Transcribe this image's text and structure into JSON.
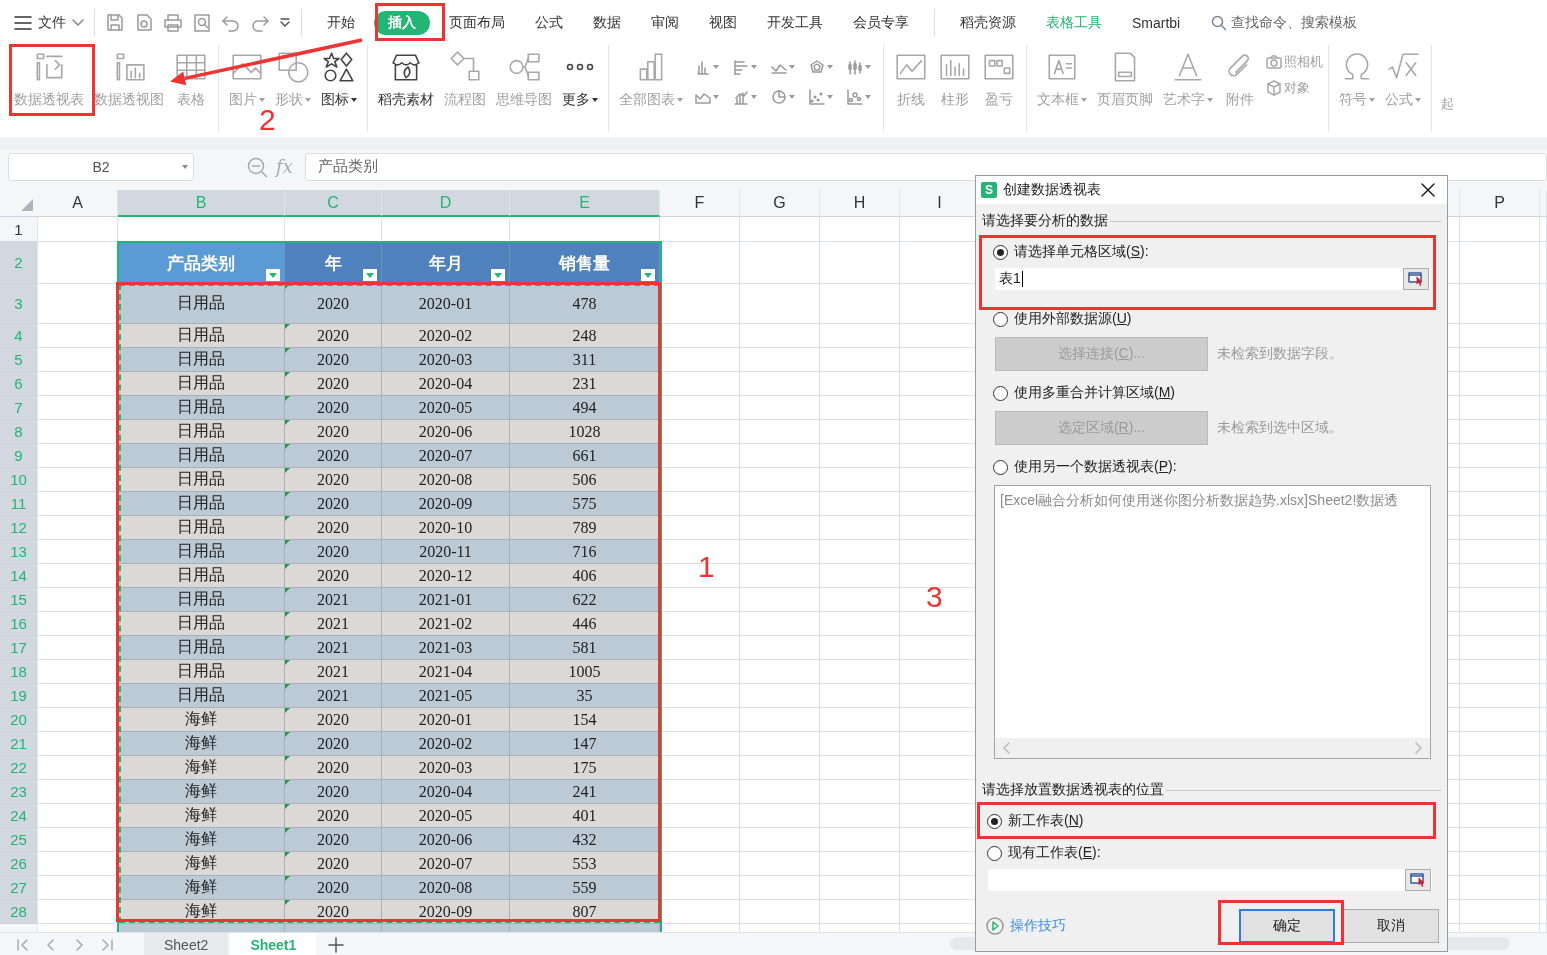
{
  "top_bar": {
    "menu_label": "文件",
    "tabs": [
      {
        "label": "开始",
        "selected": false,
        "kind": "tab"
      },
      {
        "label": "插入",
        "selected": true,
        "kind": "tab"
      },
      {
        "label": "页面布局",
        "selected": false,
        "kind": "tab"
      },
      {
        "label": "公式",
        "selected": false,
        "kind": "tab"
      },
      {
        "label": "数据",
        "selected": false,
        "kind": "tab"
      },
      {
        "label": "审阅",
        "selected": false,
        "kind": "tab"
      },
      {
        "label": "视图",
        "selected": false,
        "kind": "tab"
      },
      {
        "label": "开发工具",
        "selected": false,
        "kind": "tab"
      },
      {
        "label": "会员专享",
        "selected": false,
        "kind": "tab"
      },
      {
        "label": "稻壳资源",
        "selected": false,
        "kind": "tab"
      },
      {
        "label": "表格工具",
        "selected": false,
        "kind": "context"
      },
      {
        "label": "Smartbi",
        "selected": false,
        "kind": "tab"
      }
    ],
    "search": {
      "placeholder": "查找命令、搜索模板"
    }
  },
  "ribbon": {
    "groups": [
      [
        {
          "kind": "large",
          "label": "数据透视表",
          "disabled": true,
          "dropdown": false
        },
        {
          "kind": "large",
          "label": "数据透视图",
          "disabled": true,
          "dropdown": false
        },
        {
          "kind": "large",
          "label": "表格",
          "disabled": true,
          "dropdown": false
        }
      ],
      [
        {
          "kind": "large",
          "label": "图片",
          "disabled": true,
          "dropdown": true
        },
        {
          "kind": "large",
          "label": "形状",
          "disabled": true,
          "dropdown": true
        },
        {
          "kind": "large",
          "label": "图标",
          "disabled": false,
          "dropdown": true
        }
      ],
      [
        {
          "kind": "large",
          "label": "稻壳素材",
          "disabled": false,
          "dropdown": false
        },
        {
          "kind": "large",
          "label": "流程图",
          "disabled": true,
          "dropdown": false
        },
        {
          "kind": "large",
          "label": "思维导图",
          "disabled": true,
          "dropdown": false
        },
        {
          "kind": "large",
          "label": "更多",
          "disabled": false,
          "dropdown": true
        }
      ],
      [
        {
          "kind": "large",
          "label": "全部图表",
          "disabled": true,
          "dropdown": true
        },
        {
          "kind": "grid",
          "buttons": [
            {
              "dropdown": true
            },
            {
              "dropdown": true
            },
            {
              "dropdown": true
            },
            {
              "dropdown": true
            },
            {
              "dropdown": true
            },
            {
              "dropdown": true
            },
            {
              "dropdown": true
            },
            {
              "dropdown": true
            },
            {
              "dropdown": true
            },
            {
              "dropdown": true
            }
          ]
        }
      ],
      [
        {
          "kind": "large",
          "label": "折线",
          "disabled": true,
          "dropdown": false
        },
        {
          "kind": "large",
          "label": "柱形",
          "disabled": true,
          "dropdown": false
        },
        {
          "kind": "large",
          "label": "盈亏",
          "disabled": true,
          "dropdown": false
        }
      ],
      [
        {
          "kind": "large",
          "label": "文本框",
          "disabled": true,
          "dropdown": true
        },
        {
          "kind": "large",
          "label": "页眉页脚",
          "disabled": true,
          "dropdown": false
        },
        {
          "kind": "large",
          "label": "艺术字",
          "disabled": true,
          "dropdown": true
        },
        {
          "kind": "large",
          "label": "附件",
          "disabled": true,
          "dropdown": false
        },
        {
          "kind": "stack",
          "buttons": [
            {
              "label": "照相机",
              "disabled": true
            },
            {
              "label": "对象",
              "disabled": true
            }
          ]
        }
      ],
      [
        {
          "kind": "large",
          "label": "符号",
          "disabled": true,
          "dropdown": true
        },
        {
          "kind": "large",
          "label": "公式",
          "disabled": true,
          "dropdown": true
        }
      ],
      [
        {
          "kind": "cut",
          "label": "起",
          "disabled": true
        }
      ]
    ]
  },
  "formula_bar": {
    "name_box": "B2",
    "fx": "fx",
    "value": "产品类别"
  },
  "sheet": {
    "columns": [
      {
        "label": "A",
        "selected": false
      },
      {
        "label": "B",
        "selected": true
      },
      {
        "label": "C",
        "selected": true
      },
      {
        "label": "D",
        "selected": true
      },
      {
        "label": "E",
        "selected": true
      },
      {
        "label": "F",
        "selected": false
      },
      {
        "label": "G",
        "selected": false
      },
      {
        "label": "H",
        "selected": false
      },
      {
        "label": "I",
        "selected": false
      },
      {
        "label": "P",
        "selected": false
      }
    ],
    "rows": [
      {
        "label": "1",
        "selected": false
      },
      {
        "label": "2",
        "selected": true
      },
      {
        "label": "3",
        "selected": true
      },
      {
        "label": "4",
        "selected": true
      },
      {
        "label": "5",
        "selected": true
      },
      {
        "label": "6",
        "selected": true
      },
      {
        "label": "7",
        "selected": true
      },
      {
        "label": "8",
        "selected": true
      },
      {
        "label": "9",
        "selected": true
      },
      {
        "label": "10",
        "selected": true
      },
      {
        "label": "11",
        "selected": true
      },
      {
        "label": "12",
        "selected": true
      },
      {
        "label": "13",
        "selected": true
      },
      {
        "label": "14",
        "selected": true
      },
      {
        "label": "15",
        "selected": true
      },
      {
        "label": "16",
        "selected": true
      },
      {
        "label": "17",
        "selected": true
      },
      {
        "label": "18",
        "selected": true
      },
      {
        "label": "19",
        "selected": true
      },
      {
        "label": "20",
        "selected": true
      },
      {
        "label": "21",
        "selected": true
      },
      {
        "label": "22",
        "selected": true
      },
      {
        "label": "23",
        "selected": true
      },
      {
        "label": "24",
        "selected": true
      },
      {
        "label": "25",
        "selected": true
      },
      {
        "label": "26",
        "selected": true
      },
      {
        "label": "27",
        "selected": true
      },
      {
        "label": "28",
        "selected": true
      }
    ],
    "table": {
      "headers": [
        {
          "label": "产品类别",
          "active": true,
          "filter": true
        },
        {
          "label": "年",
          "active": false,
          "filter": true
        },
        {
          "label": "年月",
          "active": false,
          "filter": true
        },
        {
          "label": "销售量",
          "active": false,
          "filter": true
        }
      ],
      "rows": [
        [
          "日用品",
          "2020",
          "2020-01",
          "478"
        ],
        [
          "日用品",
          "2020",
          "2020-02",
          "248"
        ],
        [
          "日用品",
          "2020",
          "2020-03",
          "311"
        ],
        [
          "日用品",
          "2020",
          "2020-04",
          "231"
        ],
        [
          "日用品",
          "2020",
          "2020-05",
          "494"
        ],
        [
          "日用品",
          "2020",
          "2020-06",
          "1028"
        ],
        [
          "日用品",
          "2020",
          "2020-07",
          "661"
        ],
        [
          "日用品",
          "2020",
          "2020-08",
          "506"
        ],
        [
          "日用品",
          "2020",
          "2020-09",
          "575"
        ],
        [
          "日用品",
          "2020",
          "2020-10",
          "789"
        ],
        [
          "日用品",
          "2020",
          "2020-11",
          "716"
        ],
        [
          "日用品",
          "2020",
          "2020-12",
          "406"
        ],
        [
          "日用品",
          "2021",
          "2021-01",
          "622"
        ],
        [
          "日用品",
          "2021",
          "2021-02",
          "446"
        ],
        [
          "日用品",
          "2021",
          "2021-03",
          "581"
        ],
        [
          "日用品",
          "2021",
          "2021-04",
          "1005"
        ],
        [
          "日用品",
          "2021",
          "2021-05",
          "35"
        ],
        [
          "海鲜",
          "2020",
          "2020-01",
          "154"
        ],
        [
          "海鲜",
          "2020",
          "2020-02",
          "147"
        ],
        [
          "海鲜",
          "2020",
          "2020-03",
          "175"
        ],
        [
          "海鲜",
          "2020",
          "2020-04",
          "241"
        ],
        [
          "海鲜",
          "2020",
          "2020-05",
          "401"
        ],
        [
          "海鲜",
          "2020",
          "2020-06",
          "432"
        ],
        [
          "海鲜",
          "2020",
          "2020-07",
          "553"
        ],
        [
          "海鲜",
          "2020",
          "2020-08",
          "559"
        ],
        [
          "海鲜",
          "2020",
          "2020-09",
          "807"
        ]
      ],
      "text_number_flags": true
    }
  },
  "sheet_tabs": [
    {
      "label": "Sheet2",
      "selected": false
    },
    {
      "label": "Sheet1",
      "selected": true
    }
  ],
  "dialog": {
    "badge": "S",
    "title": "创建数据透视表",
    "source_legend": "请选择要分析的数据",
    "source_options": [
      {
        "kind": "range",
        "label": [
          "请选择单元格区域(",
          "S",
          "):"
        ],
        "selected": true,
        "value": "表1",
        "focused": true
      },
      {
        "kind": "button",
        "label": [
          "使用外部数据源(",
          "U",
          ")"
        ],
        "selected": false,
        "button": [
          "选择连接(",
          "C",
          ")..."
        ],
        "button_disabled": true,
        "note": "未检索到数据字段。"
      },
      {
        "kind": "button",
        "label": [
          "使用多重合并计算区域(",
          "M",
          ")"
        ],
        "selected": false,
        "button": [
          "选定区域(",
          "R",
          ")..."
        ],
        "button_disabled": true,
        "note": "未检索到选中区域。"
      },
      {
        "kind": "list",
        "label": [
          "使用另一个数据透视表(",
          "P",
          "):"
        ],
        "selected": false,
        "list_text": "[Excel融合分析如何使用迷你图分析数据趋势.xlsx]Sheet2!数据透"
      }
    ],
    "target_legend": "请选择放置数据透视表的位置",
    "target_options": [
      {
        "kind": "plain",
        "label": [
          "新工作表(",
          "N",
          ")"
        ],
        "selected": true
      },
      {
        "kind": "range",
        "label": [
          "现有工作表(",
          "E",
          "):"
        ],
        "selected": false,
        "focused": false
      }
    ],
    "tips_link": "操作技巧",
    "buttons": [
      {
        "label": "确定",
        "default": true
      },
      {
        "label": "取消",
        "default": false
      }
    ]
  },
  "annotations": [
    {
      "label": "1"
    },
    {
      "label": "2"
    },
    {
      "label": "3"
    }
  ]
}
